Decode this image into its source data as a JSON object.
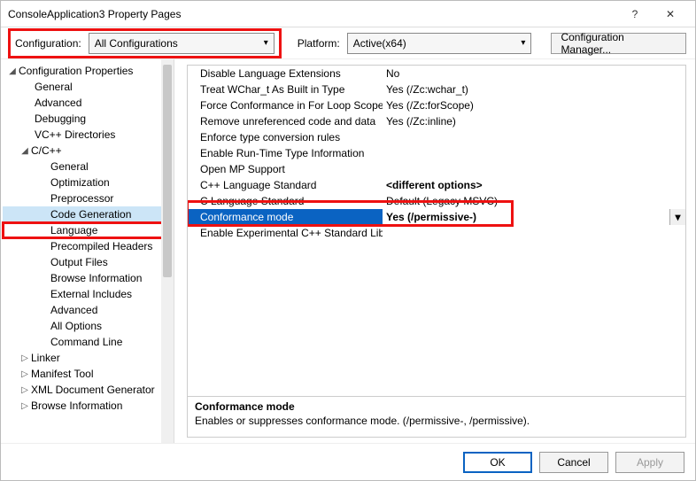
{
  "window": {
    "title": "ConsoleApplication3 Property Pages",
    "help_icon": "?",
    "close_icon": "✕"
  },
  "config_bar": {
    "config_label": "Configuration:",
    "config_value": "All Configurations",
    "platform_label": "Platform:",
    "platform_value": "Active(x64)",
    "manager_button": "Configuration Manager..."
  },
  "tree": {
    "root": "Configuration Properties",
    "items": [
      {
        "label": "General"
      },
      {
        "label": "Advanced"
      },
      {
        "label": "Debugging"
      },
      {
        "label": "VC++ Directories"
      }
    ],
    "cc": {
      "label": "C/C++",
      "children": [
        {
          "label": "General"
        },
        {
          "label": "Optimization"
        },
        {
          "label": "Preprocessor"
        },
        {
          "label": "Code Generation"
        },
        {
          "label": "Language"
        },
        {
          "label": "Precompiled Headers"
        },
        {
          "label": "Output Files"
        },
        {
          "label": "Browse Information"
        },
        {
          "label": "External Includes"
        },
        {
          "label": "Advanced"
        },
        {
          "label": "All Options"
        },
        {
          "label": "Command Line"
        }
      ]
    },
    "after": [
      {
        "label": "Linker"
      },
      {
        "label": "Manifest Tool"
      },
      {
        "label": "XML Document Generator"
      },
      {
        "label": "Browse Information"
      }
    ]
  },
  "props": [
    {
      "name": "Disable Language Extensions",
      "value": "No"
    },
    {
      "name": "Treat WChar_t As Built in Type",
      "value": "Yes (/Zc:wchar_t)"
    },
    {
      "name": "Force Conformance in For Loop Scope",
      "value": "Yes (/Zc:forScope)"
    },
    {
      "name": "Remove unreferenced code and data",
      "value": "Yes (/Zc:inline)"
    },
    {
      "name": "Enforce type conversion rules",
      "value": ""
    },
    {
      "name": "Enable Run-Time Type Information",
      "value": ""
    },
    {
      "name": "Open MP Support",
      "value": ""
    },
    {
      "name": "C++ Language Standard",
      "value": "<different options>"
    },
    {
      "name": "C Language Standard",
      "value": "Default (Legacy MSVC)"
    },
    {
      "name": "Conformance mode",
      "value": "Yes (/permissive-)"
    },
    {
      "name": "Enable Experimental C++ Standard Library",
      "value": ""
    }
  ],
  "description": {
    "title": "Conformance mode",
    "text": "Enables or suppresses conformance mode. (/permissive-, /permissive)."
  },
  "buttons": {
    "ok": "OK",
    "cancel": "Cancel",
    "apply": "Apply"
  }
}
